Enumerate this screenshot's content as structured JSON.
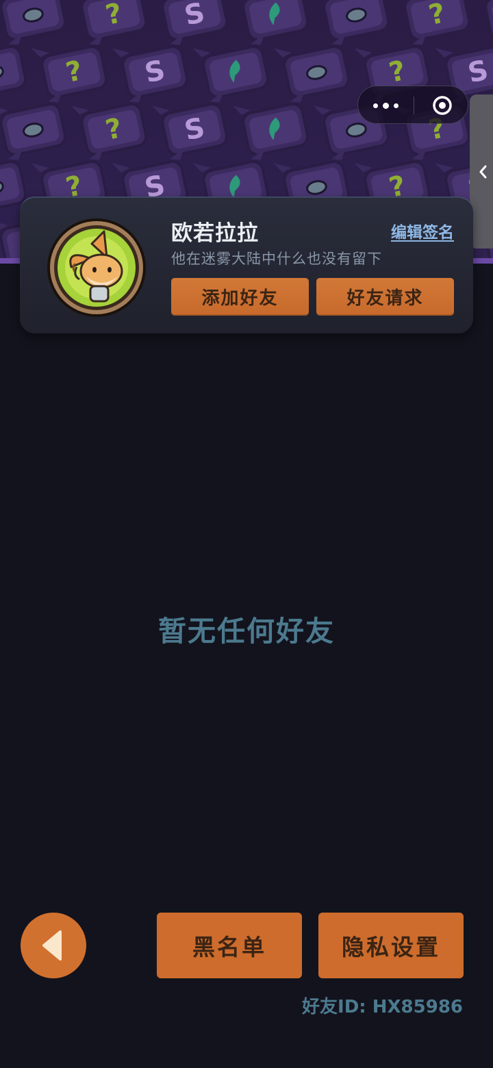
{
  "header": {
    "capsule": {
      "more_icon": "more-dots-icon",
      "close_icon": "target-close-icon"
    },
    "side_tab_icon": "chevron-left-icon"
  },
  "profile": {
    "username": "欧若拉拉",
    "edit_signature_label": "编辑签名",
    "signature": "他在迷雾大陆中什么也没有留下",
    "avatar_icon": "fox-avatar-icon",
    "add_friend_label": "添加好友",
    "friend_requests_label": "好友请求"
  },
  "main": {
    "empty_text": "暂无任何好友"
  },
  "footer": {
    "back_icon": "triangle-left-icon",
    "blacklist_label": "黑名单",
    "privacy_label": "隐私设置",
    "friend_id_text": "好友ID: HX85986"
  },
  "colors": {
    "background": "#13131d",
    "accent_orange": "#cd6c2c",
    "muted_blue": "#4c7a8f",
    "link_blue": "#8fb8e6",
    "banner_purple": "#2b1d45"
  }
}
